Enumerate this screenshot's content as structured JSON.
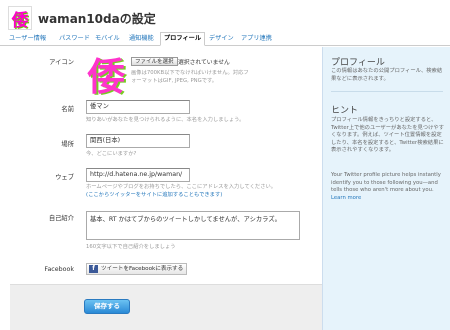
{
  "header": {
    "avatar_glyph": "倭",
    "title": "waman10daの設定"
  },
  "tabs": [
    {
      "label": "ユーザー情報"
    },
    {
      "label": "パスワード"
    },
    {
      "label": "モバイル"
    },
    {
      "label": "通知機能"
    },
    {
      "label": "プロフィール",
      "active": true
    },
    {
      "label": "デザイン"
    },
    {
      "label": "アプリ連携"
    }
  ],
  "icon": {
    "label": "アイコン",
    "glyph": "倭",
    "file_button": "ファイルを選択",
    "file_status": "選択されていません",
    "hint1": "画像は700KB以下でなければいけません。対応フ",
    "hint2": "ォーマットはGIF, JPEG, PNGです。"
  },
  "name": {
    "label": "名前",
    "value": "倭マン",
    "hint": "知りあいがあなたを見つけられるように、本名を入力しましょう。"
  },
  "location": {
    "label": "場所",
    "value": "関西(日本)",
    "hint": "今、どこにいますか?"
  },
  "web": {
    "label": "ウェブ",
    "value": "http://d.hatena.ne.jp/waman/",
    "hint1": "ホームページやブログをお持ちでしたら、ここにアドレスを入力してください。",
    "hint2": "(ここからツイッターをサイトに追加することもできます)"
  },
  "bio": {
    "label": "自己紹介",
    "value": "基本、RT かはてブからのツイートしかしてませんが、アシカラズ。",
    "hint": "160文字以下で自己紹介をしましょう"
  },
  "facebook": {
    "label": "Facebook",
    "button": "ツイートをFacebookに表示する",
    "icon": "f"
  },
  "footer": {
    "save": "保存する"
  },
  "sidebar": {
    "h1": "プロフィール",
    "p1": "この情報はあなたの公開プロフィール、検索結果などに表示されます。",
    "h2": "ヒント",
    "p2": "プロフィール情報をきっちりと設定すると、Twitter上で他のユーザーがあなたを見つけやすくなります。例えば、ツイート位置情報を設定したり、本名を設定すると、Twitter検索結果に表示されやすくなります。",
    "p3": "Your Twitter profile picture helps instantly identify you to those following you—and tells those who aren't more about you.",
    "learn": "Learn more"
  },
  "colors": {
    "link": "#2276bb",
    "save": "#2a8ad6"
  }
}
